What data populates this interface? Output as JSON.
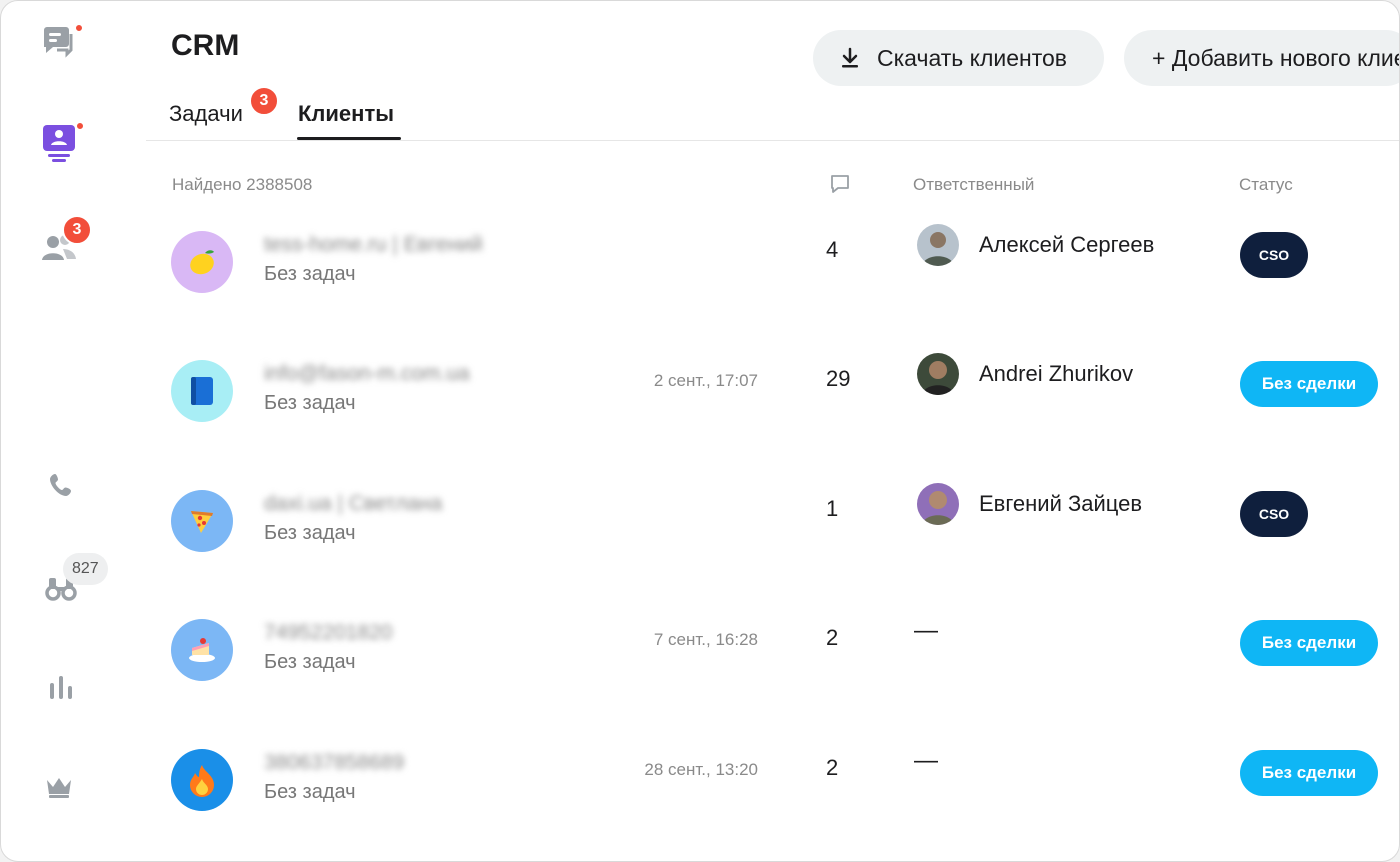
{
  "header": {
    "title": "CRM",
    "download_label": "Скачать клиентов",
    "add_label": "+ Добавить нового клиента"
  },
  "tabs": [
    {
      "label": "Задачи",
      "badge": "3"
    },
    {
      "label": "Клиенты"
    }
  ],
  "sidebar": {
    "people_badge": "3",
    "binoculars_badge": "827"
  },
  "list": {
    "found_label": "Найдено 2388508",
    "col_responsible": "Ответственный",
    "col_status": "Статус"
  },
  "rows": [
    {
      "name": "tess-home.ru | Евгений",
      "tasks": "Без задач",
      "date": "",
      "count": "4",
      "responsible": "Алексей Сергеев",
      "status": "CSO",
      "avatar": "lemon-icon",
      "avatar_bg": "#d9b8f5"
    },
    {
      "name": "info@fason-m.com.ua",
      "tasks": "Без задач",
      "date": "2 сент., 17:07",
      "count": "29",
      "responsible": "Andrei Zhurikov",
      "status": "Без сделки",
      "avatar": "book-icon",
      "avatar_bg": "#a8eef5"
    },
    {
      "name": "daxi.ua | Светлана",
      "tasks": "Без задач",
      "date": "",
      "count": "1",
      "responsible": "Евгений Зайцев",
      "status": "CSO",
      "avatar": "pizza-icon",
      "avatar_bg": "#7cb7f5"
    },
    {
      "name": "74952201820",
      "tasks": "Без задач",
      "date": "7 сент., 16:28",
      "count": "2",
      "responsible": "—",
      "status": "Без сделки",
      "avatar": "cake-icon",
      "avatar_bg": "#7cb7f5"
    },
    {
      "name": "380637858689",
      "tasks": "Без задач",
      "date": "28 сент., 13:20",
      "count": "2",
      "responsible": "—",
      "status": "Без сделки",
      "avatar": "fire-icon",
      "avatar_bg": "#1a8fe8"
    }
  ],
  "colors": {
    "badge_red": "#f24e3a",
    "status_cso": "#0f1f3d",
    "status_deal": "#0fb6f5",
    "sidebar_active": "#7b4fe0"
  }
}
